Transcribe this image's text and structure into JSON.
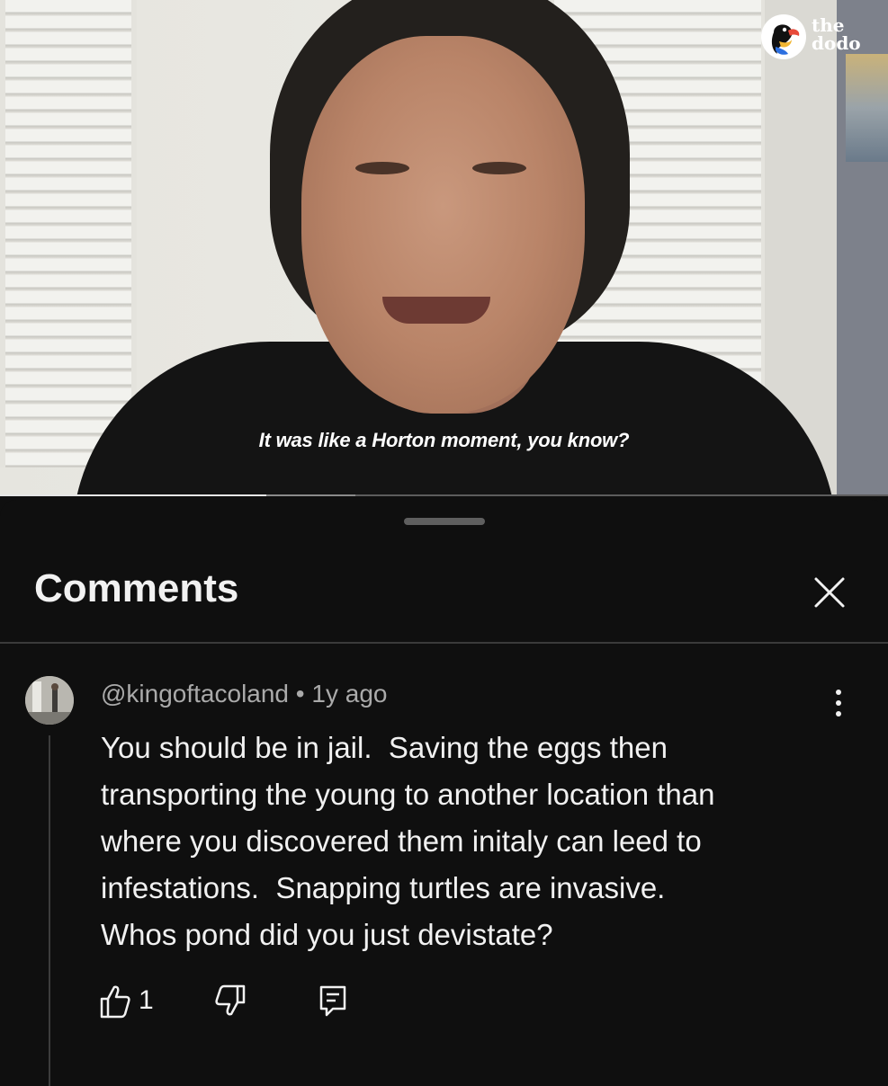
{
  "video": {
    "caption": "It was like a Horton moment, you know?",
    "logo_text": "the\ndodo",
    "progress_fraction": 0.3,
    "buffer_fraction": 0.1
  },
  "comments_panel": {
    "title": "Comments",
    "close_icon": "close-icon",
    "comment": {
      "author": "@kingoftacoland",
      "separator": "•",
      "time": "1y ago",
      "text_lines": [
        "You should be in jail.  Saving the eggs then",
        "transporting the young to another location than",
        "where you discovered them initaly can leed to",
        "infestations.  Snapping turtles are invasive.",
        "Whos pond did you just devistate?"
      ],
      "like_count": "1",
      "icons": {
        "like": "thumbs-up-icon",
        "dislike": "thumbs-down-icon",
        "reply": "reply-icon",
        "more": "more-vertical-icon"
      }
    }
  },
  "colors": {
    "background": "#0f0f0f",
    "text_primary": "#f1f1f1",
    "text_secondary": "#aaaaaa"
  }
}
